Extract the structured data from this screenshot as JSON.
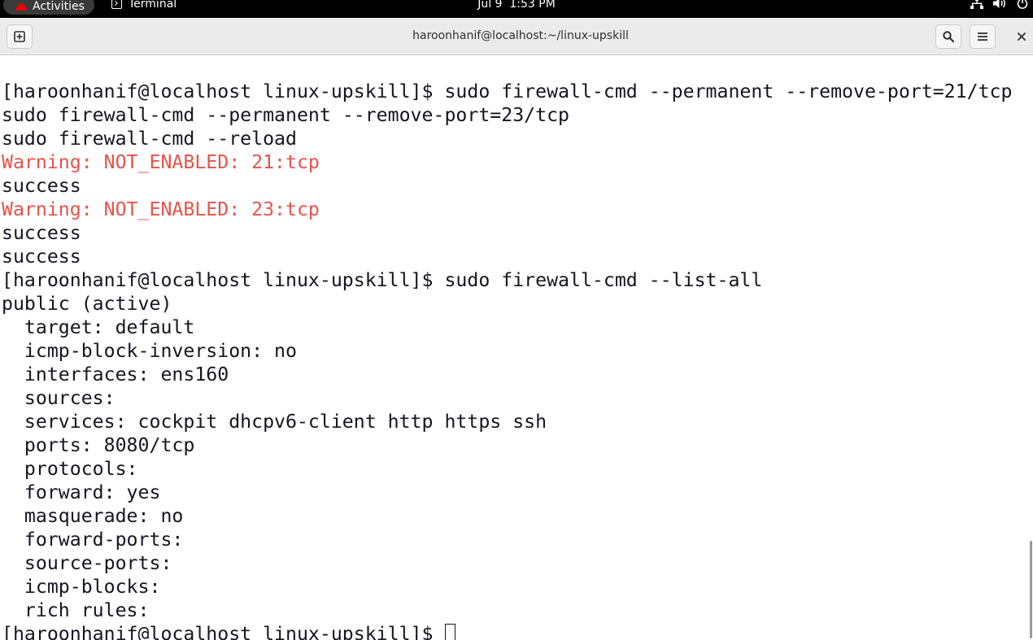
{
  "topbar": {
    "activities_label": "Activities",
    "app_label": "Terminal",
    "clock_date": "Jul 9",
    "clock_time": "1:53 PM",
    "icons": [
      "network-icon",
      "volume-icon",
      "power-icon"
    ]
  },
  "window": {
    "title": "haroonhanif@localhost:~/linux-upskill",
    "buttons": [
      "new-tab-icon",
      "search-icon",
      "hamburger-menu-icon",
      "close-icon"
    ]
  },
  "colors": {
    "warning": "#e5534b",
    "text": "#171421",
    "topbar_bg": "#000000",
    "headerbar_bg": "#ebebeb"
  },
  "terminal": {
    "lines": [
      {
        "text": "[haroonhanif@localhost linux-upskill]$ sudo firewall-cmd --permanent --remove-port=21/tcp",
        "style": "normal"
      },
      {
        "text": "sudo firewall-cmd --permanent --remove-port=23/tcp",
        "style": "normal"
      },
      {
        "text": "sudo firewall-cmd --reload",
        "style": "normal"
      },
      {
        "text": "Warning: NOT_ENABLED: 21:tcp",
        "style": "warning"
      },
      {
        "text": "success",
        "style": "normal"
      },
      {
        "text": "Warning: NOT_ENABLED: 23:tcp",
        "style": "warning"
      },
      {
        "text": "success",
        "style": "normal"
      },
      {
        "text": "success",
        "style": "normal"
      },
      {
        "text": "[haroonhanif@localhost linux-upskill]$ sudo firewall-cmd --list-all",
        "style": "normal"
      },
      {
        "text": "public (active)",
        "style": "normal"
      },
      {
        "text": "  target: default",
        "style": "normal"
      },
      {
        "text": "  icmp-block-inversion: no",
        "style": "normal"
      },
      {
        "text": "  interfaces: ens160",
        "style": "normal"
      },
      {
        "text": "  sources: ",
        "style": "normal"
      },
      {
        "text": "  services: cockpit dhcpv6-client http https ssh",
        "style": "normal"
      },
      {
        "text": "  ports: 8080/tcp",
        "style": "normal"
      },
      {
        "text": "  protocols: ",
        "style": "normal"
      },
      {
        "text": "  forward: yes",
        "style": "normal"
      },
      {
        "text": "  masquerade: no",
        "style": "normal"
      },
      {
        "text": "  forward-ports: ",
        "style": "normal"
      },
      {
        "text": "  source-ports: ",
        "style": "normal"
      },
      {
        "text": "  icmp-blocks: ",
        "style": "normal"
      },
      {
        "text": "  rich rules: ",
        "style": "normal"
      }
    ],
    "prompt": "[haroonhanif@localhost linux-upskill]$ "
  }
}
